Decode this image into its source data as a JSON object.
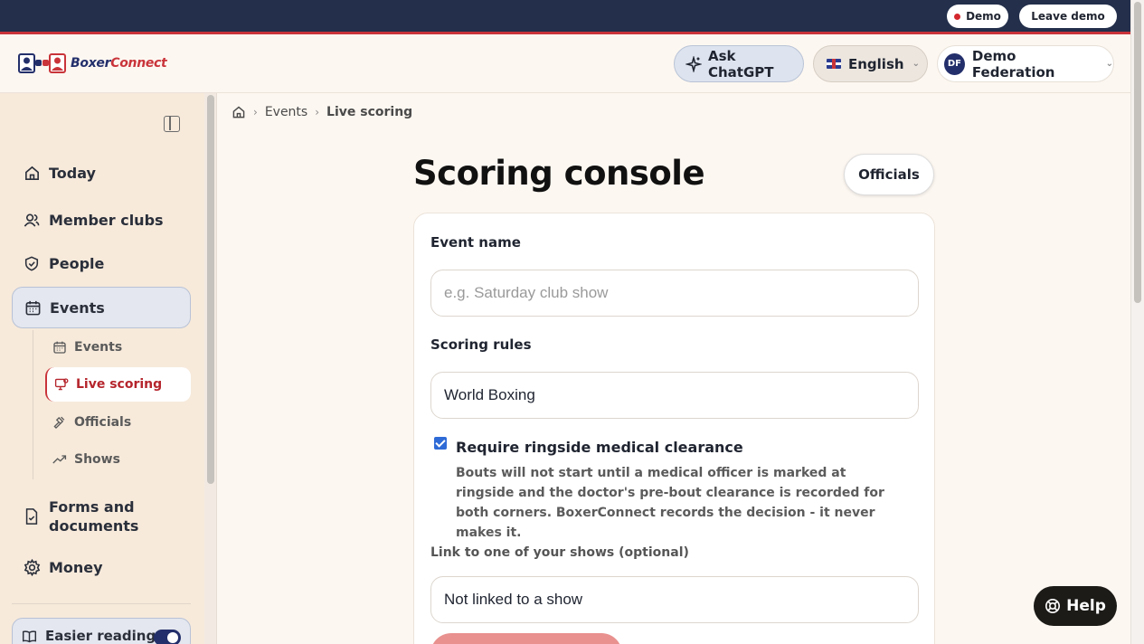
{
  "demo_bar": {
    "demo_label": "Demo",
    "leave_label": "Leave demo",
    "colors": {
      "bar": "#232f4b",
      "accent": "#c9343a"
    }
  },
  "header": {
    "logo": {
      "part1": "Boxer",
      "part2": "Connect"
    },
    "ask_chatgpt": "Ask ChatGPT",
    "language": "English",
    "federation": {
      "initials": "DF",
      "name": "Demo Federation"
    }
  },
  "sidebar": {
    "items": [
      {
        "label": "Today",
        "icon": "home-icon"
      },
      {
        "label": "Member clubs",
        "icon": "users-icon"
      },
      {
        "label": "People",
        "icon": "shield-icon"
      },
      {
        "label": "Events",
        "icon": "calendar-icon"
      },
      {
        "label": "Forms and documents",
        "icon": "document-icon"
      },
      {
        "label": "Money",
        "icon": "gear-icon"
      }
    ],
    "sub_items": [
      {
        "label": "Events",
        "icon": "calendar-icon"
      },
      {
        "label": "Live scoring",
        "icon": "monitor-icon"
      },
      {
        "label": "Officials",
        "icon": "gavel-icon"
      },
      {
        "label": "Shows",
        "icon": "trend-icon"
      }
    ],
    "easier_reading": "Easier reading"
  },
  "breadcrumb": {
    "events": "Events",
    "current": "Live scoring"
  },
  "main": {
    "title": "Scoring console",
    "officials_button": "Officials",
    "form": {
      "event_name_label": "Event name",
      "event_name_placeholder": "e.g. Saturday club show",
      "scoring_rules_label": "Scoring rules",
      "scoring_rules_value": "World Boxing",
      "medical_checkbox_label": "Require ringside medical clearance",
      "medical_checked": true,
      "medical_description": "Bouts will not start until a medical officer is marked at ringside and the doctor's pre-bout clearance is recorded for both corners. BoxerConnect records the decision - it never makes it.",
      "link_show_label": "Link to one of your shows (optional)",
      "link_show_value": "Not linked to a show"
    }
  },
  "help_button": "Help"
}
